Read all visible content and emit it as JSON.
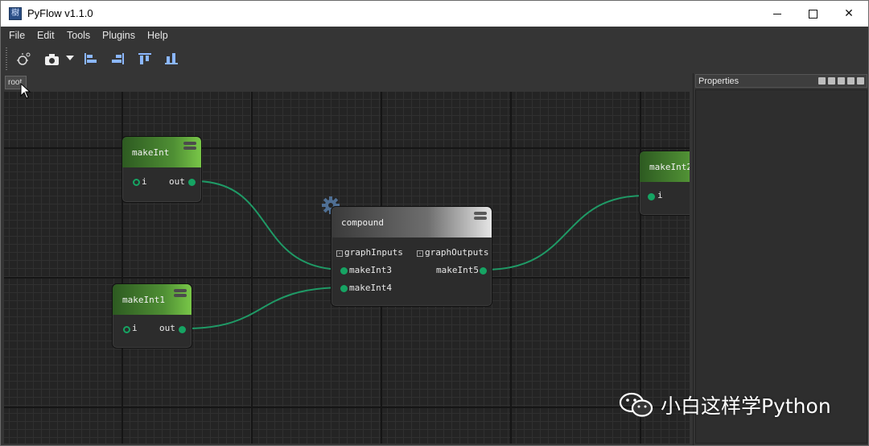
{
  "window": {
    "title": "PyFlow v1.1.0",
    "app_icon": "pyflow-app-icon",
    "controls": {
      "minimize": "minimize-icon",
      "maximize": "maximize-icon",
      "close": "✕"
    }
  },
  "menu": [
    "File",
    "Edit",
    "Tools",
    "Plugins",
    "Help"
  ],
  "toolbar": {
    "icons": [
      "new-file-icon",
      "screenshot-camera-icon",
      "dropdown-arrow-icon",
      "align-left-icon",
      "align-right-icon",
      "align-top-icon",
      "align-bottom-icon"
    ]
  },
  "breadcrumb": {
    "root": "root"
  },
  "properties_panel": {
    "title": "Properties"
  },
  "nodes": {
    "makeInt": {
      "title": "makeInt",
      "input": "i",
      "output": "out"
    },
    "makeInt1": {
      "title": "makeInt1",
      "input": "i",
      "output": "out"
    },
    "makeInt2": {
      "title": "makeInt2",
      "input": "i"
    },
    "compound": {
      "title": "compound",
      "inputs_group": "graphInputs",
      "outputs_group": "graphOutputs",
      "inputs": [
        "makeInt3",
        "makeInt4"
      ],
      "outputs": [
        "makeInt5"
      ]
    }
  },
  "colors": {
    "pin": "#16a463",
    "wire": "#1f9a66",
    "node_header_green": "#4f8f34",
    "canvas_bg": "#242424"
  },
  "watermark": {
    "text": "小白这样学Python"
  }
}
